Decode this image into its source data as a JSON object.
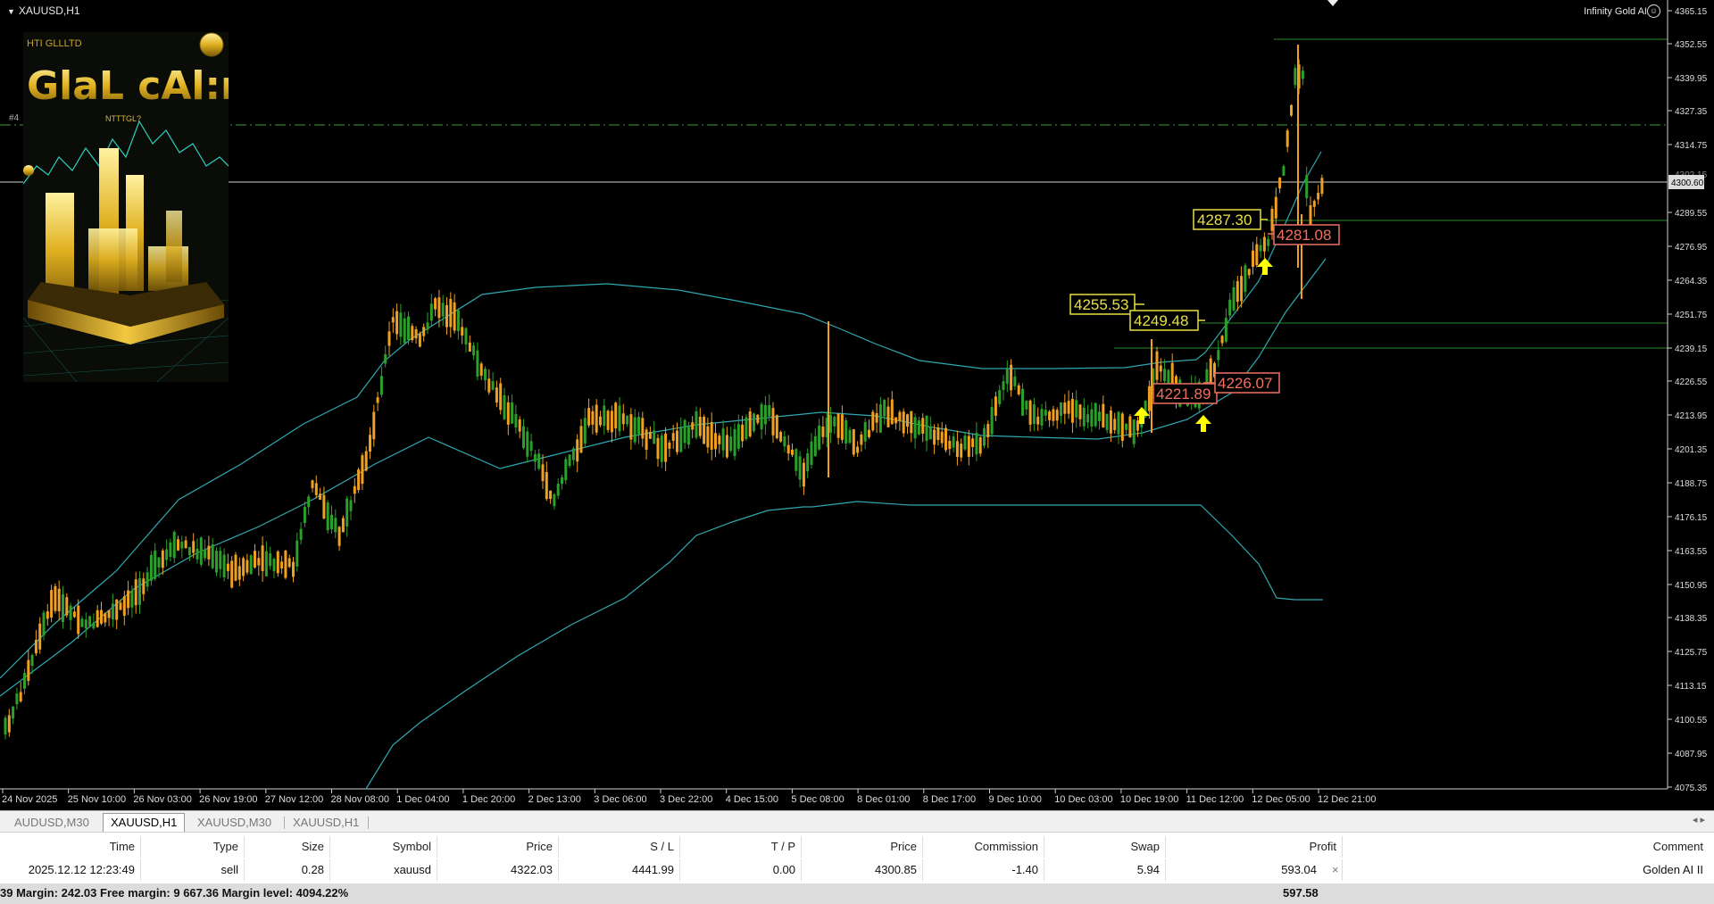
{
  "window": {
    "symbol_title": "XAUUSD,H1",
    "ea_name": "Infinity Gold AI",
    "ea_icon": "smiley-icon"
  },
  "thumbnail": {
    "top_text": "HTI GLLLTD",
    "logo_text": "GlaL cAl:r",
    "sub_text": "NTTTGL?",
    "side_label": "#4"
  },
  "price_axis": {
    "labels": [
      "4365.15",
      "4352.55",
      "4339.95",
      "4327.35",
      "4314.75",
      "4289.55",
      "4276.95",
      "4264.35",
      "4251.75",
      "4239.15",
      "4226.55",
      "4213.95",
      "4201.35",
      "4188.75",
      "4176.15",
      "4163.55",
      "4150.95",
      "4138.35",
      "4125.75",
      "4113.15",
      "4100.55",
      "4087.95",
      "4075.35"
    ],
    "current_price": "4300.60",
    "overlapped_label": "4302.15"
  },
  "time_axis": {
    "labels": [
      "24 Nov 2025",
      "25 Nov 10:00",
      "26 Nov 03:00",
      "26 Nov 19:00",
      "27 Nov 12:00",
      "28 Nov 08:00",
      "1 Dec 04:00",
      "1 Dec 20:00",
      "2 Dec 13:00",
      "3 Dec 06:00",
      "3 Dec 22:00",
      "4 Dec 15:00",
      "5 Dec 08:00",
      "8 Dec 01:00",
      "8 Dec 17:00",
      "9 Dec 10:00",
      "10 Dec 03:00",
      "10 Dec 19:00",
      "11 Dec 12:00",
      "12 Dec 05:00",
      "12 Dec 21:00"
    ]
  },
  "chart_labels": {
    "buy": [
      "4255.53",
      "4249.48",
      "4287.30"
    ],
    "sell": [
      "4221.89",
      "4226.07",
      "4281.08"
    ]
  },
  "colors": {
    "background": "#000000",
    "bull_candle": "#2aa02a",
    "bear_candle": "#f0a020",
    "band": "#2fa8b0",
    "buy_label": "#e8e040",
    "sell_label": "#f07060",
    "arrow": "#ffff00"
  },
  "tabs": [
    {
      "label": "AUDUSD,M30",
      "active": false
    },
    {
      "label": "XAUUSD,H1",
      "active": true
    },
    {
      "label": "XAUUSD,M30",
      "active": false
    },
    {
      "label": "XAUUSD,H1",
      "active": false
    }
  ],
  "tab_nav": "◂ ▸",
  "trade_table": {
    "columns": [
      "Time",
      "Type",
      "Size",
      "Symbol",
      "Price",
      "S / L",
      "T / P",
      "Price",
      "Commission",
      "Swap",
      "Profit",
      "Comment"
    ],
    "row": [
      "2025.12.12 12:23:49",
      "sell",
      "0.28",
      "xauusd",
      "4322.03",
      "4441.99",
      "0.00",
      "4300.85",
      "-1.40",
      "5.94",
      "593.04",
      "Golden AI II"
    ],
    "close_glyph": "×"
  },
  "status_bar": {
    "text": "39  Margin: 242.03  Free margin: 9 667.36  Margin level: 4094.22%",
    "total_profit": "597.58"
  }
}
